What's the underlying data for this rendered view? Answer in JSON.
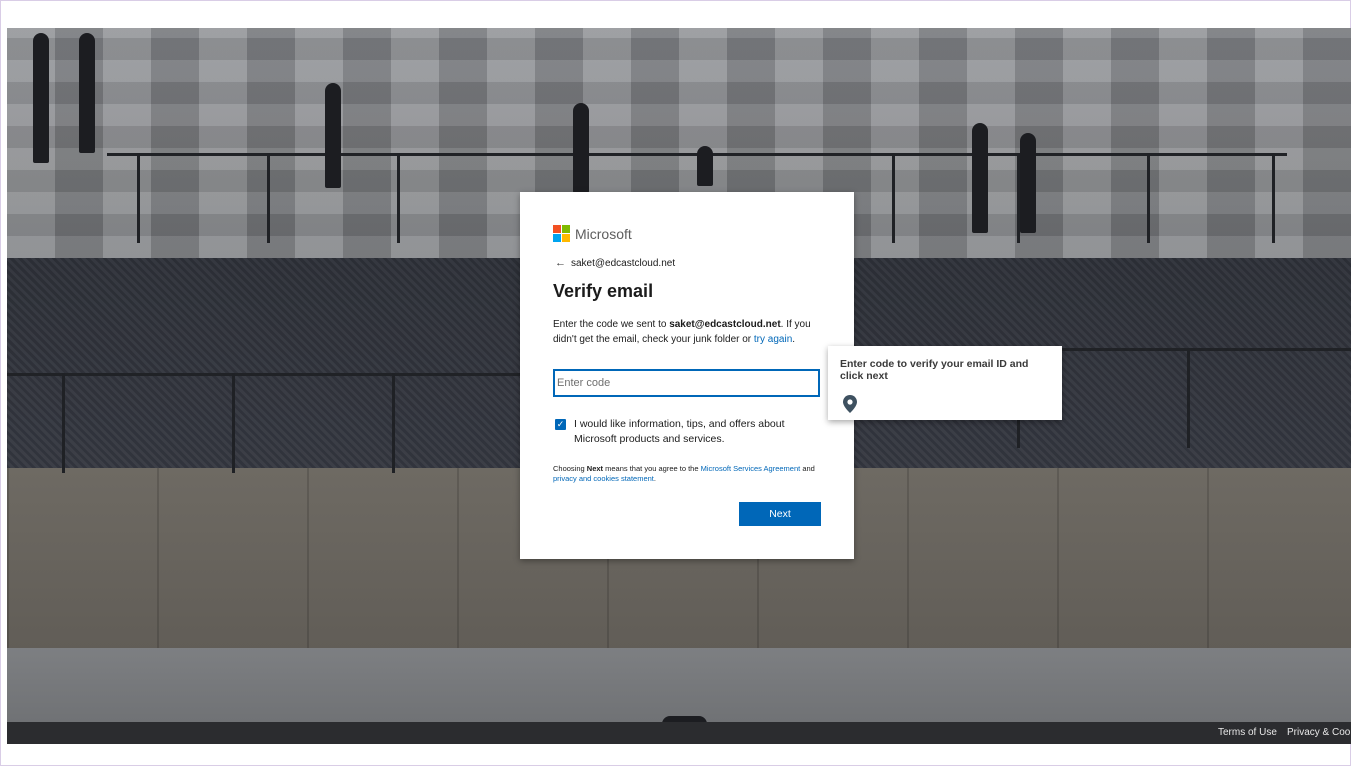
{
  "card": {
    "brand": "Microsoft",
    "back_email": "saket@edcastcloud.net",
    "title": "Verify email",
    "desc_prefix": "Enter the code we sent to ",
    "desc_email": "saket@edcastcloud.net",
    "desc_suffix": ". If you didn't get the email, check your junk folder or ",
    "try_again": "try again",
    "desc_end": ".",
    "code_placeholder": "Enter code",
    "code_value": "",
    "checkbox_checked": true,
    "checkbox_label": "I would like information, tips, and offers about Microsoft products and services.",
    "legal_prefix": "Choosing ",
    "legal_bold": "Next",
    "legal_mid": " means that you agree to the ",
    "legal_link1": "Microsoft Services Agreement",
    "legal_and": " and ",
    "legal_link2": "privacy and cookies statement",
    "legal_end": ".",
    "next_label": "Next"
  },
  "tooltip": {
    "text": "Enter code to verify your email ID and click next",
    "icon": "location-pin-icon"
  },
  "footer": {
    "terms": "Terms of Use",
    "privacy": "Privacy & Cookies"
  },
  "colors": {
    "accent": "#0067b8",
    "logo_red": "#f25022",
    "logo_green": "#7fba00",
    "logo_blue": "#00a4ef",
    "logo_yellow": "#ffb900"
  }
}
